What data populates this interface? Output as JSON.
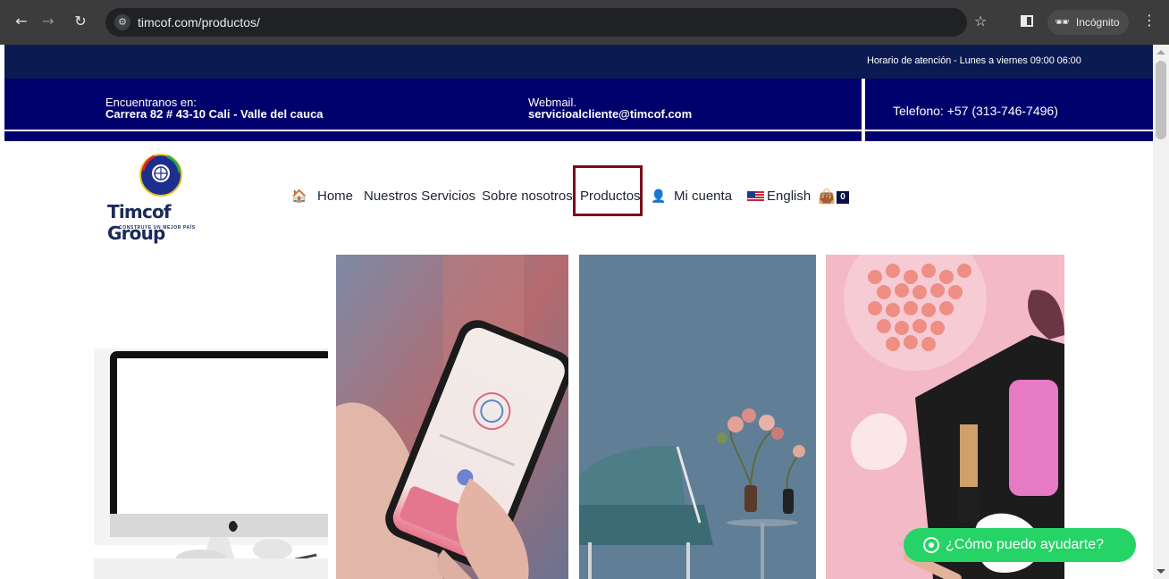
{
  "browser": {
    "url": "timcof.com/productos/",
    "incognito_label": "Incógnito"
  },
  "topbar": {
    "hours": "Horario de atención - Lunes a viernes 09:00 06:00"
  },
  "infobar": {
    "location_label": "Encuentranos en:",
    "location_value": "Carrera 82 # 43-10 Cali - Valle del cauca",
    "webmail_label": "Webmail.",
    "webmail_value": "servicioalcliente@timcof.com",
    "phone": "Telefono: +57 (313-746-7496)"
  },
  "logo": {
    "brand": "Timcof Group",
    "tagline": "CONSTRUYE UN MEJOR PAÍS"
  },
  "nav": {
    "home": "Home",
    "services": "Nuestros Servicios",
    "about": "Sobre nosotros",
    "products": "Productos",
    "account": "Mi cuenta",
    "language": "English",
    "cart_count": "0"
  },
  "products": [
    {
      "name": "computer-monitor"
    },
    {
      "name": "smartphone-in-hand"
    },
    {
      "name": "chair-and-flowers"
    },
    {
      "name": "makeup-cosmetics"
    }
  ],
  "whatsapp": {
    "label": "¿Cómo puedo ayudarte?"
  },
  "colors": {
    "topbar": "#0c1a52",
    "infobar": "#00006d",
    "highlight_box": "#7a0e1a",
    "whatsapp": "#25d366"
  }
}
